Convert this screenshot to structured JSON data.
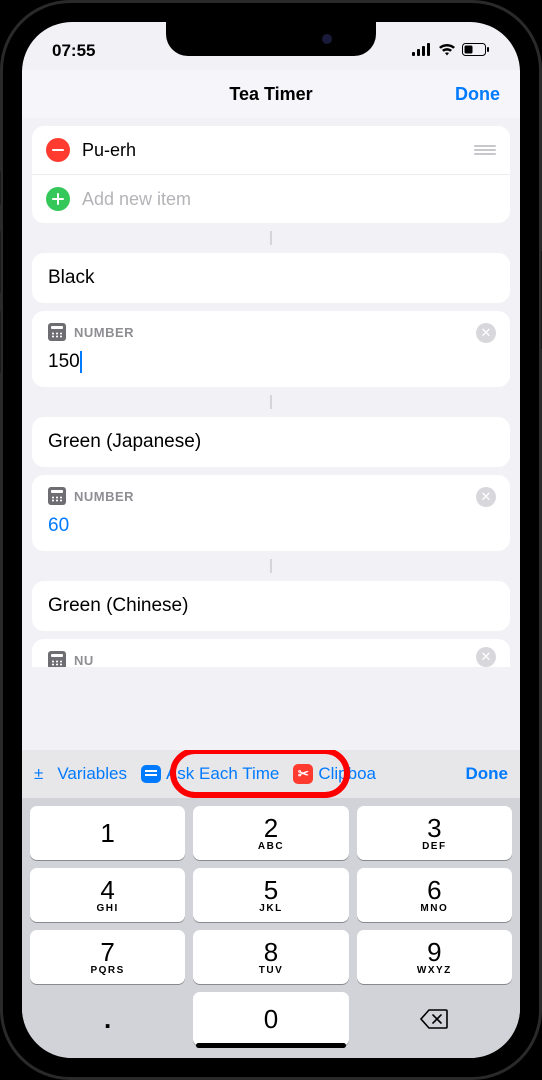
{
  "status": {
    "time": "07:55"
  },
  "nav": {
    "title": "Tea Timer",
    "done": "Done"
  },
  "list": {
    "item_label": "Pu-erh",
    "add_placeholder": "Add new item"
  },
  "sections": [
    {
      "title": "Black",
      "num_label": "NUMBER",
      "value": "150",
      "is_variable": false
    },
    {
      "title": "Green (Japanese)",
      "num_label": "NUMBER",
      "value": "60",
      "is_variable": true
    },
    {
      "title": "Green (Chinese)",
      "num_label": "NU",
      "value": "",
      "is_variable": false
    }
  ],
  "suggestions": {
    "pm": "±",
    "variables": "Variables",
    "ask": "Ask Each Time",
    "clipboard": "Clipboa",
    "done": "Done"
  },
  "keypad": {
    "rows": [
      [
        {
          "d": "1",
          "l": ""
        },
        {
          "d": "2",
          "l": "ABC"
        },
        {
          "d": "3",
          "l": "DEF"
        }
      ],
      [
        {
          "d": "4",
          "l": "GHI"
        },
        {
          "d": "5",
          "l": "JKL"
        },
        {
          "d": "6",
          "l": "MNO"
        }
      ],
      [
        {
          "d": "7",
          "l": "PQRS"
        },
        {
          "d": "8",
          "l": "TUV"
        },
        {
          "d": "9",
          "l": "WXYZ"
        }
      ]
    ],
    "dot": ".",
    "zero": "0"
  }
}
